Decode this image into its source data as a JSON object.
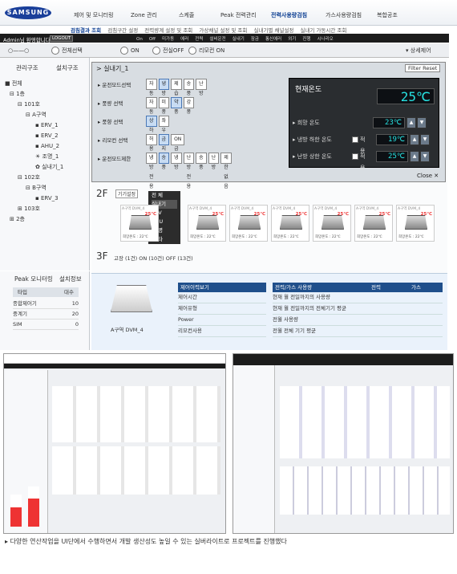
{
  "brand": "SAMSUNG",
  "nav": {
    "items": [
      "제어 및 모니터링",
      "Zone 관리",
      "스케줄",
      "Peak 전력관리",
      "전력사용량검침",
      "가스사용량검침",
      "복합공조"
    ],
    "active": 4
  },
  "subnav": {
    "items": [
      "검침결과 조회",
      "검침구간 설정",
      "전력량계 설정 및 조회",
      "가상채널 설정 및 조회",
      "실내기별 채널설정",
      "실내기 가동시간 조회"
    ]
  },
  "user": {
    "greeting": "Admin님 환영합니다",
    "logout": "LOGOUT"
  },
  "legend": [
    "On",
    "Off",
    "미가동",
    "에러",
    "전력",
    "설비운전",
    "실내기",
    "잠금",
    "통신에러",
    "외기",
    "진행",
    "시나리오"
  ],
  "toolbar": {
    "full_select": "전체선택",
    "on": "ON",
    "all_off": "전실OFF",
    "remote_on": "리모컨 ON",
    "detail": "상세제어"
  },
  "leftpanel": {
    "tab1": "관리구조",
    "tab2": "설치구조",
    "tree": [
      "전체",
      "1층",
      "101호",
      "A구역",
      "ERV_1",
      "ERV_2",
      "AHU_2",
      "조명_1",
      "실내기_1",
      "102호",
      "B구역",
      "ERV_3",
      "103호",
      "2층"
    ],
    "tab3": "Peak 모니터링",
    "tab4": "설치정보",
    "info_head": [
      "타입",
      "대수"
    ],
    "info": [
      [
        "종합제어기",
        "10"
      ],
      [
        "중계기",
        "20"
      ],
      [
        "SIM",
        "0"
      ]
    ]
  },
  "popup": {
    "title": "실내기_1",
    "filter": "Filter Reset",
    "rows": [
      {
        "label": "운전모드선택",
        "btns": [
          "자동",
          "냉방",
          "제습",
          "송풍",
          "난방"
        ]
      },
      {
        "label": "풍량 선택",
        "btns": [
          "자동풍",
          "미풍",
          "약풍",
          "강풍"
        ]
      },
      {
        "label": "풍향 선택",
        "btns": [
          "상하",
          "좌우"
        ]
      },
      {
        "label": "리모컨 선택",
        "btns": [
          "허용",
          "금지",
          "ON금지"
        ]
      },
      {
        "label": "운전모드제한",
        "btns": [
          "냉방전용",
          "송풍",
          "냉방",
          "난방전용",
          "송풍",
          "난방",
          "제한없음"
        ]
      }
    ],
    "close": "Close"
  },
  "temp": {
    "current_label": "현재온도",
    "current": "25℃",
    "rows": [
      {
        "label": "희망 온도",
        "val": "23℃",
        "apply": ""
      },
      {
        "label": "냉방 하한 온도",
        "val": "19℃",
        "apply": "적용"
      },
      {
        "label": "난방 상한 온도",
        "val": "25℃",
        "apply": "적용"
      }
    ]
  },
  "floor2": {
    "label": "2F",
    "kisel": "기기설정",
    "menu": [
      "전 체",
      "실내기",
      "ERV",
      "AHU",
      "조 명",
      "기 타"
    ],
    "unit_title": "A구역 DVM_4",
    "unit_temp": "25℃",
    "unit_hope": "희망온도 : 22℃",
    "unit_mode": "냉방"
  },
  "floor3": {
    "label": "3F",
    "info": "고장 (1건)   ON (10건)   OFF (13건)"
  },
  "bottom": {
    "device": "A구역 DVM_4",
    "table1_head": "제어이력보기",
    "table1": [
      "제어시간",
      "제어유형",
      "Power",
      "리모컨사용"
    ],
    "table2_head": "전력/가스 사용량",
    "col1": "전력",
    "col2": "가스",
    "table2": [
      "현재 월 전일까지의 사용량",
      "현재 월 전일까지의 전체기기 평균",
      "전월 사용량",
      "전월 전체 기기 평균"
    ]
  },
  "caption": "다양한 연산작업을 UI단에서 수행하면서 개발 생산성도 높일 수 있는 실버라이트로 프로젝트를 진행했다"
}
